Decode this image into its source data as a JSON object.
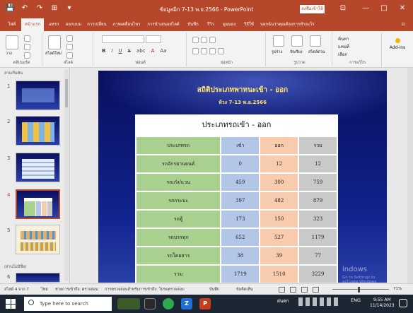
{
  "window": {
    "title": "ข้อมูลมิก 7-13 พ.ย.2566 - PowerPoint",
    "sign_in": "ลงชื่อเข้าใช้",
    "qat": [
      "💾",
      "↶",
      "↷",
      "⊞",
      "▾"
    ],
    "controls": {
      "ribbon_options": "⊡",
      "minimize": "—",
      "maximize": "□",
      "close": "✕"
    }
  },
  "menu": {
    "tabs": [
      "ไฟล์",
      "หน้าแรก",
      "แทรก",
      "ออกแบบ",
      "การเปลี่ยน",
      "ภาพเคลื่อนไหว",
      "การนำเสนอสไลด์",
      "บันทึก",
      "รีวิว",
      "มุมมอง",
      "วิธีใช้"
    ],
    "tell_me": "บอกฉันว่าคุณต้องการทำอะไร",
    "share": "⊡"
  },
  "ribbon": {
    "groups": [
      "คลิปบอร์ด",
      "สไลด์",
      "ฟอนต์",
      "ย่อหน้า",
      "รูปวาด",
      "การแก้ไข",
      "Add-ins"
    ],
    "paste_label": "วาง",
    "new_slide_label": "สไลด์ใหม่",
    "font_name": "",
    "font_size": "",
    "format_buttons": [
      "B",
      "I",
      "U",
      "S",
      "abc",
      "A",
      "Aa"
    ],
    "shapes_label": "รูปร่าง",
    "arrange_label": "จัดเรียง",
    "styles_label": "สไตล์ด่วน",
    "find_label": "ค้นหา",
    "replace_label": "แทนที่",
    "select_label": "เลือก",
    "addins_label": "Add-ins"
  },
  "slides_pane": {
    "section1": "ส่วนเริ่มต้น",
    "section2": "(ส่วนไม่มีชื่อ)",
    "numbers": [
      "1",
      "2",
      "3",
      "4",
      "5",
      "6"
    ],
    "selected": 4
  },
  "slide": {
    "title": "สถิติประเภทพาหนะเข้า - ออก",
    "subtitle": "ห้วง 7-13 พ.ย.2566",
    "table_heading": "ประเภทรถเข้า - ออก",
    "columns": [
      "ประเภทรถ",
      "เข้า",
      "ออก",
      "รวม"
    ],
    "rows": [
      [
        "รถจักรยานยนต์",
        "0",
        "12",
        "12"
      ],
      [
        "รถเก๋ง/แวน",
        "459",
        "300",
        "759"
      ],
      [
        "รถกระบะ",
        "397",
        "482",
        "879"
      ],
      [
        "รถตู้",
        "173",
        "150",
        "323"
      ],
      [
        "รถบรรทุก",
        "652",
        "527",
        "1179"
      ],
      [
        "รถโดยสาร",
        "38",
        "39",
        "77"
      ],
      [
        "รวม",
        "1719",
        "1510",
        "3229"
      ]
    ],
    "watermark1": "indows",
    "watermark2": "Go to Settings to activate Windows"
  },
  "status": {
    "slide_pos": "สไลด์ 4 จาก 7",
    "lang": "ไทย",
    "accessibility": "ช่วยการเข้าถึง: ตรวจสอบ",
    "note": "การตรวจสอบสำหรับการเข้าถึง: โปรดตรวจสอบ",
    "notes_btn": "บันทึก",
    "comments_btn": "ข้อคิดเห็น",
    "zoom": "71%"
  },
  "taskbar": {
    "search_placeholder": "Type here to search",
    "tray_lang": "ENG",
    "tray_weather": "ฝนตก",
    "time": "9:55 AM",
    "date": "11/14/2023"
  }
}
